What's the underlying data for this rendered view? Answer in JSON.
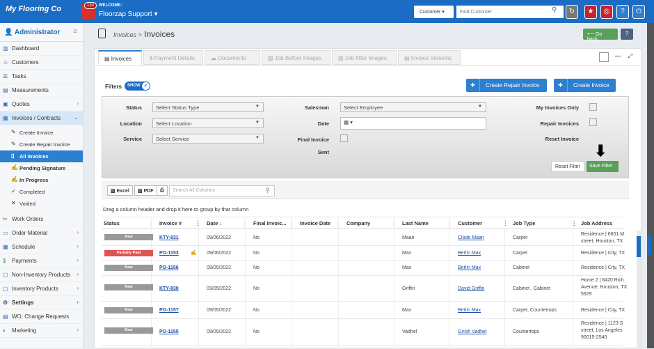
{
  "topbar": {
    "brand": "My Flooring Co",
    "bell_count": "133",
    "welcome_label": "WELCOME:",
    "company": "Floorzap Support",
    "customer_select": "Customer",
    "search_placeholder": "Find Customer"
  },
  "sidebar": {
    "title": "Administrator",
    "items_top": [
      {
        "label": "Dashboard",
        "icon": "chart-icon"
      },
      {
        "label": "Customers",
        "icon": "users-icon"
      },
      {
        "label": "Tasks",
        "icon": "list-icon"
      },
      {
        "label": "Measurements",
        "icon": "ruler-icon"
      },
      {
        "label": "Quotes",
        "icon": "quote-icon"
      },
      {
        "label": "Invoices / Contracts",
        "icon": "invoice-icon"
      }
    ],
    "subitems": [
      {
        "label": "Create Invoice",
        "icon": "edit-icon"
      },
      {
        "label": "Create Repair Invoice",
        "icon": "edit-icon"
      },
      {
        "label": "All Invoices",
        "icon": "file-icon"
      },
      {
        "label": "Pending Signature",
        "icon": "sign-icon"
      },
      {
        "label": "In Progress",
        "icon": "sign-icon"
      },
      {
        "label": "Completed",
        "icon": "check-icon"
      },
      {
        "label": "Voided",
        "icon": "x-icon"
      }
    ],
    "items_bottom": [
      {
        "label": "Work Orders"
      },
      {
        "label": "Order Material"
      },
      {
        "label": "Schedule"
      },
      {
        "label": "Payments"
      },
      {
        "label": "Non-Inventory Products"
      },
      {
        "label": "Inventory Products"
      },
      {
        "label": "Settings"
      },
      {
        "label": "WO. Change Requests"
      },
      {
        "label": "Marketing"
      }
    ]
  },
  "header": {
    "crumb_parent": "Invoices >",
    "crumb_current": "Invoices",
    "go_back": "Go back",
    "help": "?"
  },
  "tabs": [
    "Invoices",
    "Payment Details",
    "Documents",
    "Job Before Images",
    "Job After Images",
    "Invoice Versions"
  ],
  "filters": {
    "label": "Filters",
    "toggle": "SHOW",
    "create_repair": "Create Repair Invoice",
    "create_invoice": "Create Invoice",
    "status_label": "Status",
    "status_value": "Select Status Type",
    "location_label": "Location",
    "location_value": "Select Location",
    "service_label": "Service",
    "service_value": "Select Service",
    "salesman_label": "Salesman",
    "salesman_value": "Select Employee",
    "date_label": "Date",
    "final_label": "Final Invoice",
    "sent_label": "Sent",
    "my_invoices": "My Invoices Only",
    "repair_invoices": "Repair Invoices",
    "reset_invoice": "Reset Invoice",
    "reset_filter": "Reset Filter",
    "save_filter": "Save Filter"
  },
  "grid": {
    "excel": "Excel",
    "pdf": "PDF",
    "search_placeholder": "Search All Columns",
    "drag_hint": "Drag a column header and drop it here to group by that column",
    "columns": [
      "Status",
      "Invoice #",
      "Date",
      "Final Invoic...",
      "Invoice Date",
      "Company",
      "Last Name",
      "Customer",
      "Job Type",
      "Job Address"
    ],
    "rows": [
      {
        "status": "New",
        "status_color": "#999999",
        "invoice": "KTY-831",
        "date": "09/06/2022",
        "final": "No",
        "last": "Maan",
        "customer": "Clode Maan",
        "job": "Carpet",
        "addr": [
          "Residence | 6651 M",
          "street, Houston, TX"
        ]
      },
      {
        "status": "Partially Paid",
        "status_color": "#e05353",
        "invoice": "PO-1153",
        "date": "09/06/2022",
        "final": "No",
        "last": "Max",
        "customer": "Berlin Max",
        "job": "Carpet",
        "addr": [
          "Residence | City, TX"
        ]
      },
      {
        "status": "New",
        "status_color": "#999999",
        "invoice": "PO-1156",
        "date": "09/05/2022",
        "final": "No",
        "last": "Max",
        "customer": "Berlin Max",
        "job": "Cabinet",
        "addr": [
          "Residence | City, TX"
        ]
      },
      {
        "status": "New",
        "status_color": "#999999",
        "invoice": "KTY-830",
        "date": "09/05/2022",
        "final": "No",
        "last": "Griffin",
        "customer": "David Griffin",
        "job": "Cabinet , Cabinet",
        "addr": [
          "Home 2 | 6420 Rich",
          "Avenue, Houston, TX",
          "5929"
        ]
      },
      {
        "status": "New",
        "status_color": "#999999",
        "invoice": "PO-1157",
        "date": "09/05/2022",
        "final": "No",
        "last": "Max",
        "customer": "Berlin Max",
        "job": "Carpet, Countertops",
        "addr": [
          "Residence | City, TX"
        ]
      },
      {
        "status": "New",
        "status_color": "#999999",
        "invoice": "PO-1155",
        "date": "09/05/2022",
        "final": "No",
        "last": "Vadhel",
        "customer": "Girish Vadhel",
        "job": "Countertops",
        "addr": [
          "Residence | 1123 S",
          "street, Los Angeles",
          "90015-2540"
        ]
      }
    ]
  }
}
